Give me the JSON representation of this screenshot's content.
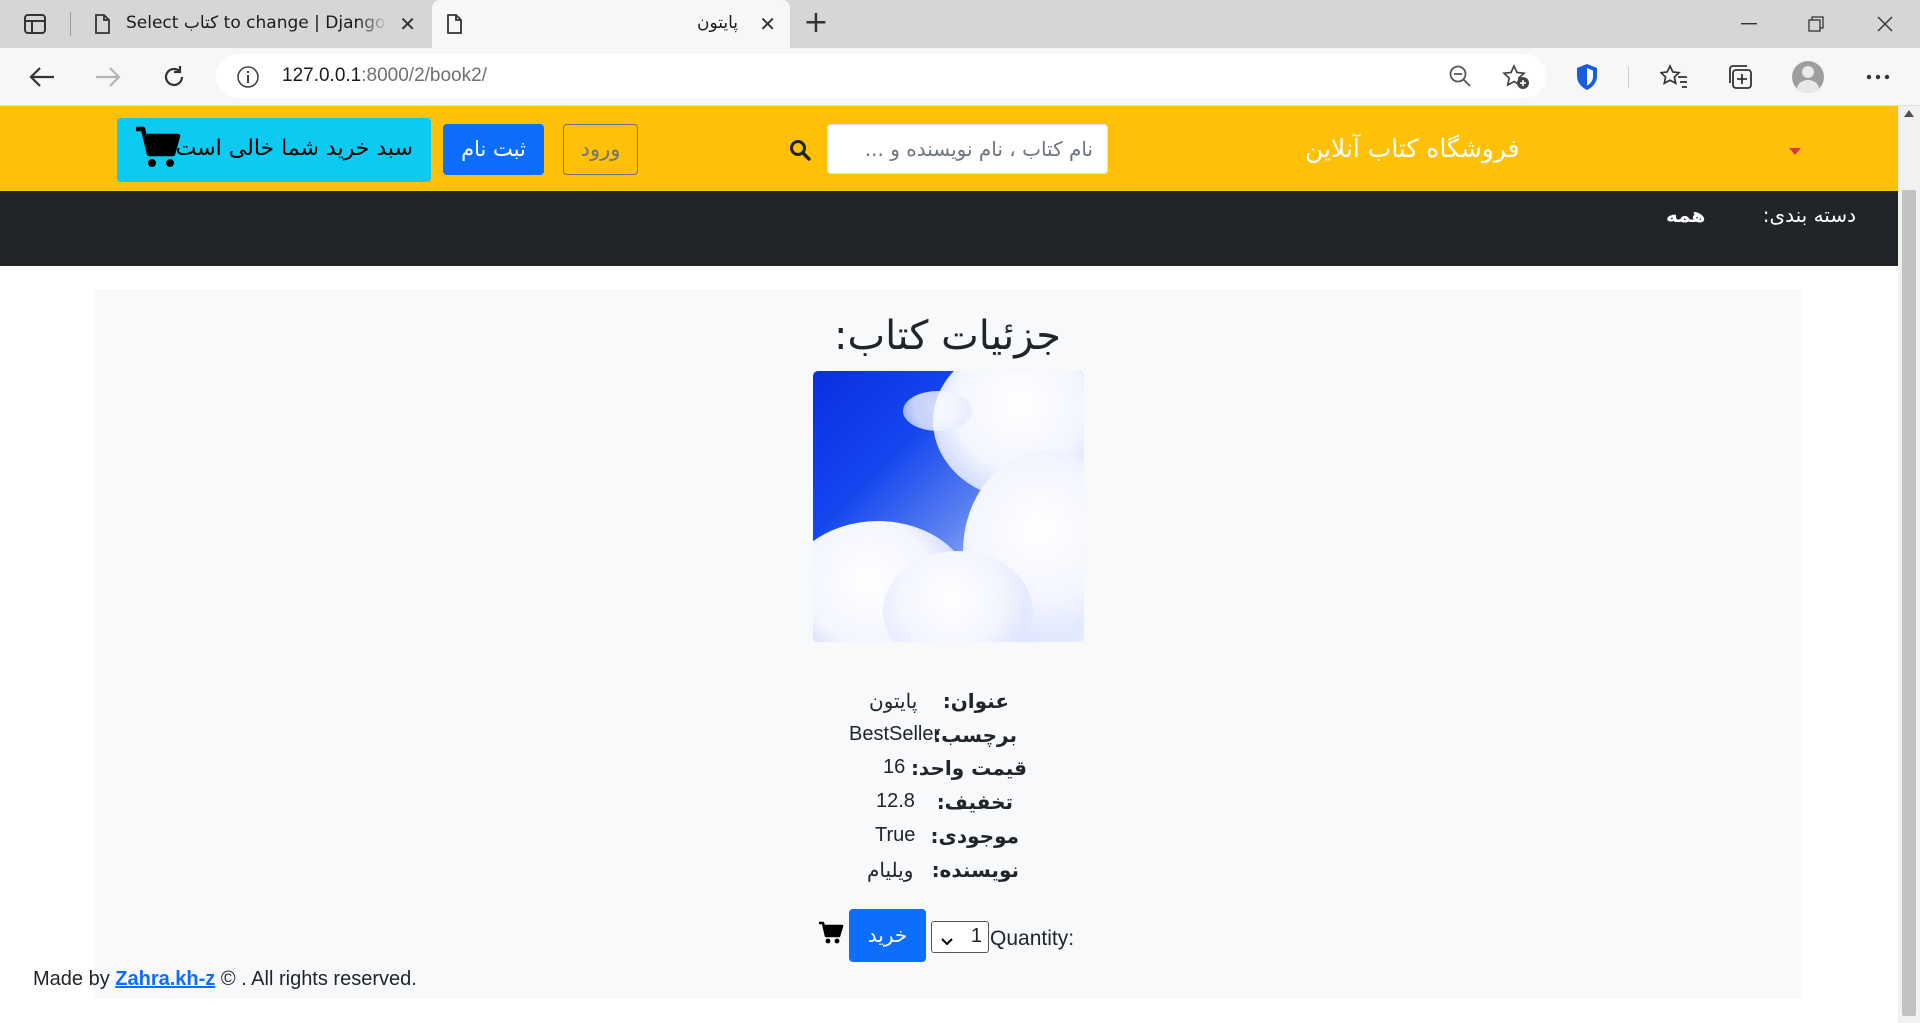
{
  "browser": {
    "tabs": [
      {
        "title": "Select کتاب to change | Django site admin",
        "active": false
      },
      {
        "title": "پایتون",
        "active": true
      }
    ],
    "url_host": "127.0.0.1",
    "url_rest": ":8000/2/book2/"
  },
  "header": {
    "brand": "فروشگاه کتاب آنلاین",
    "search_placeholder": "نام کتاب ، نام نویسنده و ...",
    "login_label": "ورود",
    "register_label": "ثبت نام",
    "cart_label": "سبد خرید شما خالی است",
    "accent_color": "#ffc107"
  },
  "categories": {
    "label": "دسته بندی:",
    "items": [
      "همه"
    ]
  },
  "book": {
    "page_title": "جزئیات کتاب:",
    "fields": [
      {
        "label": "عنوان:",
        "value": "پایتون"
      },
      {
        "label": "برچسب:",
        "value": "BestSeller"
      },
      {
        "label": "قیمت واحد:",
        "value": "16"
      },
      {
        "label": "تخفیف:",
        "value": "12.8"
      },
      {
        "label": "موجودی:",
        "value": "True"
      },
      {
        "label": "نویسنده:",
        "value": "ویلیام"
      }
    ]
  },
  "purchase": {
    "quantity_label": "Quantity:",
    "quantity_value": "1",
    "buy_label": "خرید"
  },
  "footer": {
    "prefix": "Made by",
    "author": "Zahra.kh-z",
    "suffix": "© . All rights reserved."
  }
}
